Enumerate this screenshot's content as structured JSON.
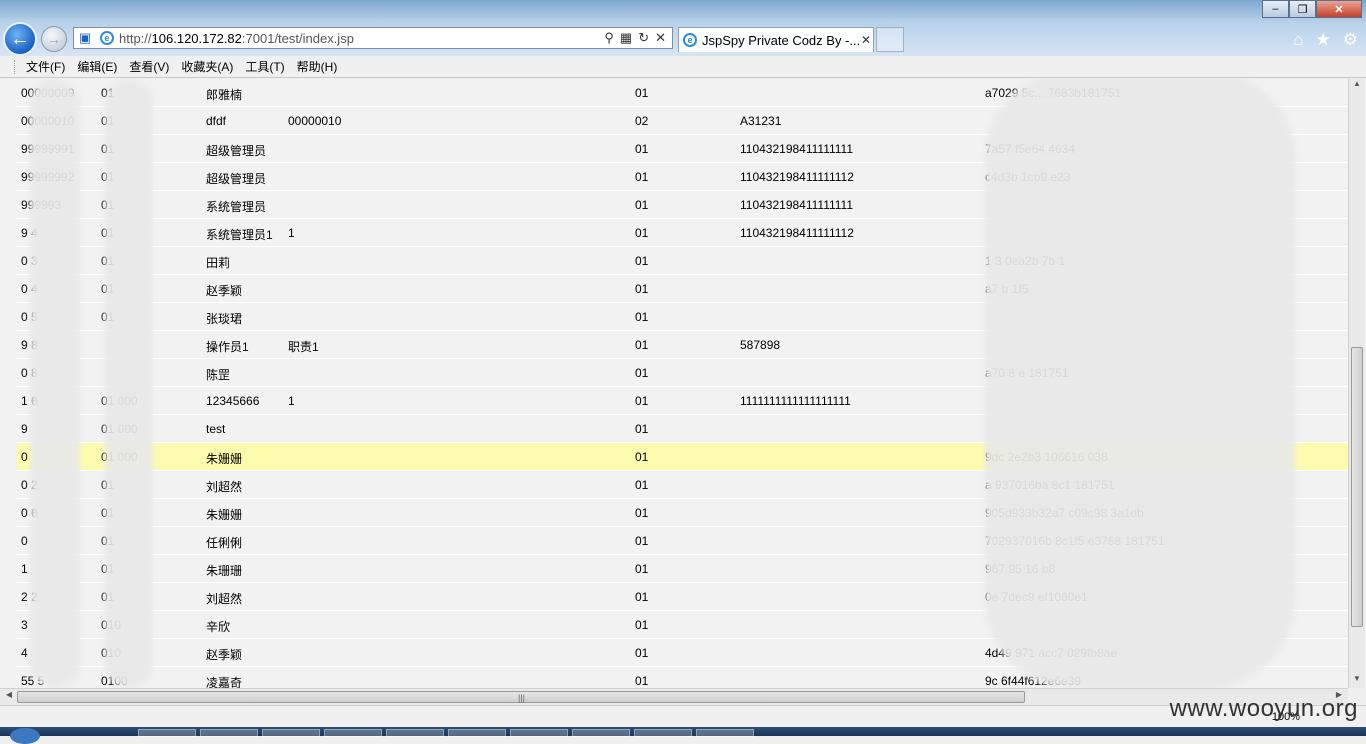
{
  "browser": {
    "url_prefix": "http://",
    "url_host": "106.120.172.82",
    "url_path": ":7001/test/index.jsp",
    "tab_title": "JspSpy Private Codz By -...",
    "zoom": "100%"
  },
  "menu": [
    "文件(F)",
    "编辑(E)",
    "查看(V)",
    "收藏夹(A)",
    "工具(T)",
    "帮助(H)"
  ],
  "rows": [
    {
      "id": "00000009",
      "code": "01",
      "name": "郎雅楠",
      "extra": "",
      "type": "01",
      "card": "",
      "hash": "a7029  5c...   7683b181751"
    },
    {
      "id": "00000010",
      "code": "01",
      "name": "dfdf",
      "extra": "00000010",
      "type": "02",
      "card": "A31231",
      "hash": ""
    },
    {
      "id": "99999991",
      "code": "01",
      "name": "超级管理员",
      "extra": "",
      "type": "01",
      "card": "110432198411111111",
      "hash": "7a57         f5e64           4634"
    },
    {
      "id": "99999992",
      "code": "01",
      "name": "超级管理员",
      "extra": "",
      "type": "01",
      "card": "110432198411111112",
      "hash": "c4d3b          1cb9           e23"
    },
    {
      "id": "999993",
      "code": "01",
      "name": "系统管理员",
      "extra": "",
      "type": "01",
      "card": "110432198411111111",
      "hash": ""
    },
    {
      "id": "9    4",
      "code": "01",
      "name": "系统管理员1",
      "extra": "1",
      "type": "01",
      "card": "110432198411111112",
      "hash": ""
    },
    {
      "id": "0    3",
      "code": "01",
      "name": "田莉",
      "extra": "",
      "type": "01",
      "card": "",
      "hash": "1           3   0ea2b     7b    1"
    },
    {
      "id": "0    4",
      "code": "01",
      "name": "赵季颖",
      "extra": "",
      "type": "01",
      "card": "",
      "hash": "a7          b        1f5"
    },
    {
      "id": "0    5",
      "code": "01",
      "name": "张琰珺",
      "extra": "",
      "type": "01",
      "card": "",
      "hash": ""
    },
    {
      "id": "9    8",
      "code": "",
      "name": "操作员1",
      "extra": "职责1",
      "type": "01",
      "card": "587898",
      "hash": ""
    },
    {
      "id": "0    8",
      "code": "",
      "name": "陈罡",
      "extra": "",
      "type": "01",
      "card": "",
      "hash": "a70              8     e     181751"
    },
    {
      "id": "1    6",
      "code": "01  000",
      "name": "12345666",
      "extra": "1",
      "type": "01",
      "card": "1111111111111111111",
      "hash": ""
    },
    {
      "id": "9",
      "code": "01  000",
      "name": "test",
      "extra": "",
      "type": "01",
      "card": "",
      "hash": ""
    },
    {
      "id": "0",
      "code": "01  000",
      "name": "朱姗姗",
      "extra": "",
      "type": "01",
      "card": "",
      "hash": "9dc    2e2b3           106616     038",
      "highlight": true
    },
    {
      "id": "0    2",
      "code": "01",
      "name": "刘超然",
      "extra": "",
      "type": "01",
      "card": "",
      "hash": "a    937016ba       8c1         181751"
    },
    {
      "id": "0    6",
      "code": "01",
      "name": "朱姗姗",
      "extra": "",
      "type": "01",
      "card": "",
      "hash": "905d933b32a7          c09c98     3a1db"
    },
    {
      "id": "0",
      "code": "01",
      "name": "任俐俐",
      "extra": "",
      "type": "01",
      "card": "",
      "hash": "702937016b       8c1f5    e3768     181751"
    },
    {
      "id": "1",
      "code": "01",
      "name": "朱珊珊",
      "extra": "",
      "type": "01",
      "card": "",
      "hash": "     967       95          16          b8"
    },
    {
      "id": "2    2",
      "code": "01",
      "name": "刘超然",
      "extra": "",
      "type": "01",
      "card": "",
      "hash": "0e           7dec9         ef1060e1"
    },
    {
      "id": "3",
      "code": "010",
      "name": "辛欣",
      "extra": "",
      "type": "01",
      "card": "",
      "hash": ""
    },
    {
      "id": "4",
      "code": "010",
      "name": "赵季颖",
      "extra": "",
      "type": "01",
      "card": "",
      "hash": "4d49      971   acc7         029fb8ae"
    },
    {
      "id": "55    5",
      "code": "0100",
      "name": "凌嘉奇",
      "extra": "",
      "type": "01",
      "card": "",
      "hash": "            9c    6f44f612e6e39"
    }
  ],
  "watermark": "www.wooyun.org"
}
